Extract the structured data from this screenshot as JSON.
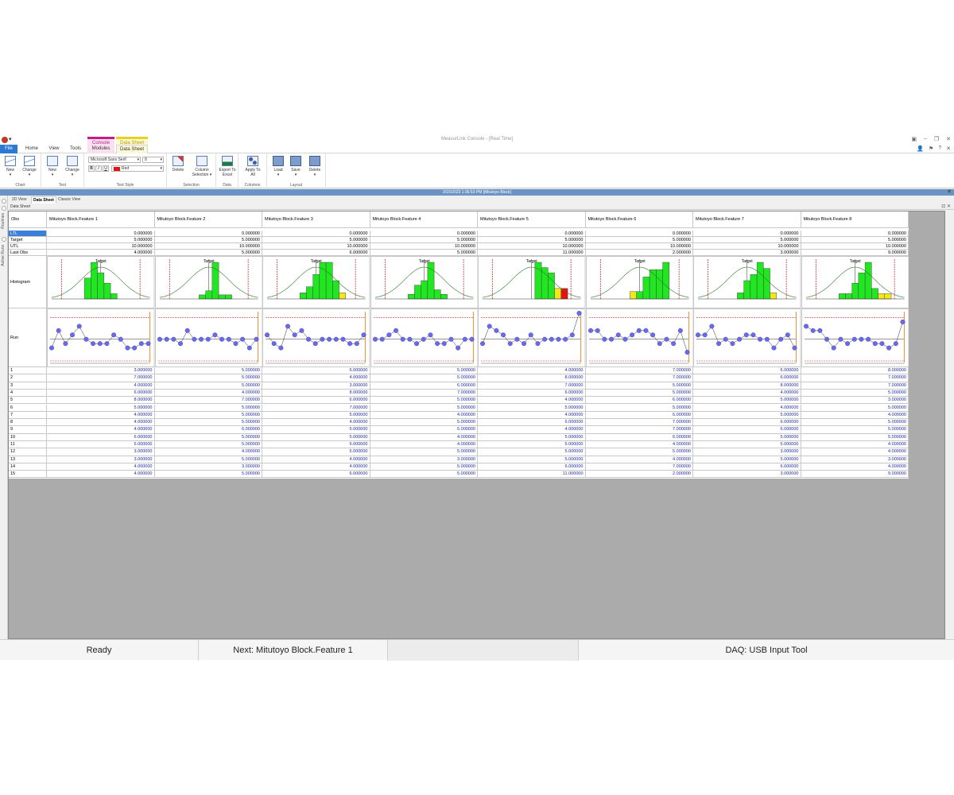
{
  "window": {
    "title": "MeasurLink Console - [Real Time]",
    "context_tabs": [
      "Console",
      "Data Sheet"
    ]
  },
  "tabs": [
    "File",
    "Home",
    "View",
    "Tools",
    "Modules",
    "Data Sheet"
  ],
  "ribbon": {
    "chart": {
      "label": "Chart",
      "new": "New",
      "change": "Change"
    },
    "text": {
      "label": "Text",
      "new": "New",
      "change": "Change"
    },
    "text_style": {
      "label": "Text Style",
      "font": "Microsoft Sans Serif",
      "size": "8",
      "color_name": "Red",
      "color": "#e81010",
      "bold": "B",
      "italic": "I",
      "underline": "U"
    },
    "selection": {
      "label": "Selection",
      "delete": "Delete",
      "column_selection": "Column Selection"
    },
    "data": {
      "label": "Data",
      "export": "Export To Excel"
    },
    "columns": {
      "label": "Columns",
      "apply": "Apply To All"
    },
    "layout": {
      "label": "Layout",
      "load": "Load",
      "save": "Save",
      "delete": "Delete"
    }
  },
  "infobar": "3/15/2023 1:36:53 PM [Mitutoyo Block]",
  "left_strip": [
    "Routines",
    "Active Runs"
  ],
  "subtabs": [
    "2D View",
    "Data Sheet",
    "Classic View"
  ],
  "datasheet_title": "Data Sheet",
  "grid": {
    "obs_label": "Obs",
    "row_labels": [
      "LTL",
      "Target",
      "UTL",
      "Last Obs",
      "Histogram",
      "Run"
    ],
    "features": [
      {
        "name": "Mitutoyo Block.Feature 1",
        "ltl": "0.000000",
        "target": "5.000000",
        "utl": "10.000000",
        "last": "4.000000"
      },
      {
        "name": "Mitutoyo Block.Feature 2",
        "ltl": "0.000000",
        "target": "5.000000",
        "utl": "10.000000",
        "last": "5.000000"
      },
      {
        "name": "Mitutoyo Block.Feature 3",
        "ltl": "0.000000",
        "target": "5.000000",
        "utl": "10.000000",
        "last": "6.000000"
      },
      {
        "name": "Mitutoyo Block.Feature 4",
        "ltl": "0.000000",
        "target": "5.000000",
        "utl": "10.000000",
        "last": "5.000000"
      },
      {
        "name": "Mitutoyo Block.Feature 5",
        "ltl": "0.000000",
        "target": "5.000000",
        "utl": "10.000000",
        "last": "11.000000"
      },
      {
        "name": "Mitutoyo Block.Feature 6",
        "ltl": "0.000000",
        "target": "5.000000",
        "utl": "10.000000",
        "last": "2.000000"
      },
      {
        "name": "Mitutoyo Block.Feature 7",
        "ltl": "0.000000",
        "target": "5.000000",
        "utl": "10.000000",
        "last": "3.000000"
      },
      {
        "name": "Mitutoyo Block.Feature 8",
        "ltl": "0.000000",
        "target": "5.000000",
        "utl": "10.000000",
        "last": "9.000000"
      }
    ],
    "observations": [
      [
        "3.000000",
        "5.000000",
        "6.000000",
        "5.000000",
        "4.000000",
        "7.000000",
        "6.000000",
        "8.000000"
      ],
      [
        "7.000000",
        "5.000000",
        "4.000000",
        "5.000000",
        "8.000000",
        "7.000000",
        "6.000000",
        "7.000000"
      ],
      [
        "4.000000",
        "5.000000",
        "3.000000",
        "6.000000",
        "7.000000",
        "5.000000",
        "8.000000",
        "7.000000"
      ],
      [
        "6.000000",
        "4.000000",
        "8.000000",
        "7.000000",
        "6.000000",
        "5.000000",
        "4.000000",
        "5.000000"
      ],
      [
        "8.000000",
        "7.000000",
        "6.000000",
        "5.000000",
        "4.000000",
        "6.000000",
        "5.000000",
        "3.000000"
      ],
      [
        "5.000000",
        "5.000000",
        "7.000000",
        "5.000000",
        "5.000000",
        "5.000000",
        "4.000000",
        "5.000000"
      ],
      [
        "4.000000",
        "5.000000",
        "5.000000",
        "4.000000",
        "4.000000",
        "6.000000",
        "5.000000",
        "4.000000"
      ],
      [
        "4.000000",
        "5.000000",
        "4.000000",
        "5.000000",
        "6.000000",
        "7.000000",
        "6.000000",
        "5.000000"
      ],
      [
        "4.000000",
        "6.000000",
        "5.000000",
        "6.000000",
        "4.000000",
        "7.000000",
        "6.000000",
        "5.000000"
      ],
      [
        "6.000000",
        "5.000000",
        "5.000000",
        "4.000000",
        "5.000000",
        "6.000000",
        "5.000000",
        "5.000000"
      ],
      [
        "5.000000",
        "5.000000",
        "5.000000",
        "4.000000",
        "5.000000",
        "4.000000",
        "5.000000",
        "4.000000"
      ],
      [
        "3.000000",
        "4.000000",
        "5.000000",
        "5.000000",
        "5.000000",
        "5.000000",
        "3.000000",
        "4.000000"
      ],
      [
        "3.000000",
        "5.000000",
        "4.000000",
        "3.000000",
        "5.000000",
        "4.000000",
        "5.000000",
        "3.000000"
      ],
      [
        "4.000000",
        "3.000000",
        "4.000000",
        "5.000000",
        "6.000000",
        "7.000000",
        "6.000000",
        "4.000000"
      ],
      [
        "4.000000",
        "5.000000",
        "6.000000",
        "5.000000",
        "11.000000",
        "2.000000",
        "3.000000",
        "9.000000"
      ]
    ],
    "histograms": [
      {
        "counts": [
          0,
          0,
          0,
          0,
          0,
          4,
          7,
          5,
          3,
          1,
          0,
          0,
          0,
          0,
          0
        ],
        "color_over": [
          10
        ]
      },
      {
        "counts": [
          0,
          0,
          0,
          0,
          0,
          0,
          1,
          2,
          9,
          1,
          1,
          0,
          0,
          0,
          0
        ],
        "color_over": []
      },
      {
        "counts": [
          0,
          0,
          0,
          0,
          0,
          1,
          2,
          4,
          6,
          6,
          3,
          1,
          0,
          0,
          0
        ],
        "color_over": [
          11
        ]
      },
      {
        "counts": [
          0,
          0,
          0,
          0,
          0,
          1,
          3,
          4,
          8,
          2,
          1,
          0,
          0,
          0,
          0
        ],
        "color_over": []
      },
      {
        "counts": [
          0,
          0,
          0,
          0,
          0,
          0,
          0,
          0,
          7,
          6,
          5,
          2,
          2,
          0,
          0
        ],
        "color_over": [
          11
        ],
        "red": [
          12
        ]
      },
      {
        "counts": [
          0,
          0,
          0,
          0,
          0,
          0,
          1,
          1,
          3,
          4,
          4,
          5,
          0,
          0,
          0
        ],
        "color_over": [
          6
        ]
      },
      {
        "counts": [
          0,
          0,
          0,
          0,
          0,
          0,
          1,
          3,
          4,
          6,
          5,
          1,
          0,
          0,
          0
        ],
        "color_over": [
          11
        ]
      },
      {
        "counts": [
          0,
          0,
          0,
          0,
          0,
          1,
          1,
          3,
          5,
          7,
          2,
          1,
          1,
          0,
          0
        ],
        "color_over": [
          11,
          12
        ]
      }
    ],
    "hist_labels": [
      "Target"
    ]
  },
  "colors": {
    "hist_bar": "#22e622",
    "hist_warn": "#f2e61c",
    "hist_bad": "#e81010",
    "run_point": "#6a6ae8",
    "limit_line": "#cc3333",
    "selected": "#3c7fd8"
  },
  "status": {
    "ready": "Ready",
    "next": "Next: Mitutoyo Block.Feature 1",
    "daq": "DAQ: USB Input Tool"
  }
}
